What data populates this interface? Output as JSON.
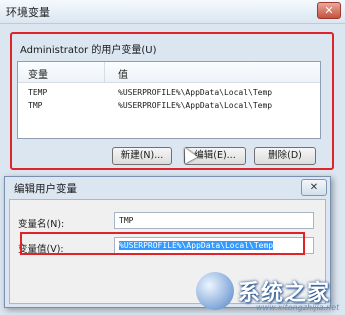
{
  "window": {
    "title": "环境变量",
    "close_glyph": "✕"
  },
  "user_vars": {
    "group_label": "Administrator 的用户变量(U)",
    "columns": [
      "变量",
      "值"
    ],
    "rows": [
      {
        "name": "TEMP",
        "value": "%USERPROFILE%\\AppData\\Local\\Temp"
      },
      {
        "name": "TMP",
        "value": "%USERPROFILE%\\AppData\\Local\\Temp"
      }
    ],
    "buttons": {
      "new": "新建(N)...",
      "edit": "编辑(E)...",
      "delete": "删除(D)"
    }
  },
  "edit_dialog": {
    "title": "编辑用户变量",
    "close_glyph": "✕",
    "name_label": "变量名(N):",
    "name_value": "TMP",
    "value_label": "变量值(V):",
    "value_value": "%USERPROFILE%\\AppData\\Local\\Temp"
  },
  "watermark": {
    "text": "系统之家",
    "url": "www.xitongzhijia.net"
  },
  "colors": {
    "highlight_border": "#e0232a",
    "selection": "#3399ff",
    "window_bg": "#dbe6f1"
  },
  "icons": [
    "close-icon",
    "mouse-cursor-icon",
    "watermark-logo-icon"
  ]
}
